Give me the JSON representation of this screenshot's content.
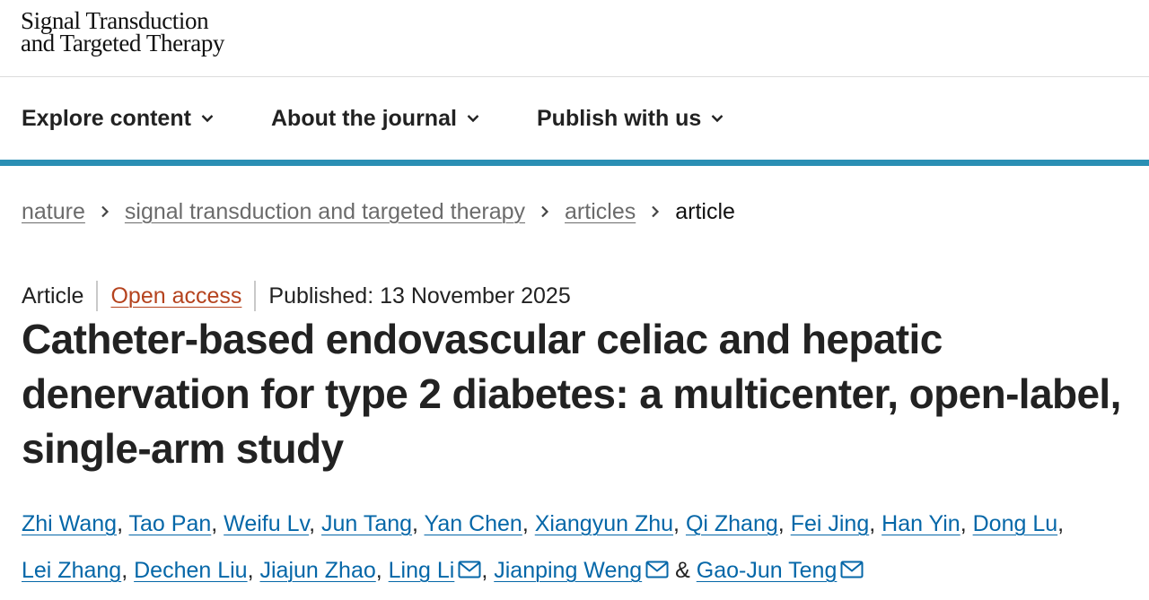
{
  "header": {
    "logo_line1": "Signal Transduction",
    "logo_line2": "and Targeted Therapy"
  },
  "nav": {
    "items": [
      {
        "label": "Explore content",
        "icon": "chevron-down-icon"
      },
      {
        "label": "About the journal",
        "icon": "chevron-down-icon"
      },
      {
        "label": "Publish with us",
        "icon": "chevron-down-icon"
      }
    ],
    "accent_color": "#2a8fb4"
  },
  "breadcrumb": {
    "items": [
      "nature",
      "signal transduction and targeted therapy",
      "articles"
    ],
    "current": "article"
  },
  "article": {
    "type": "Article",
    "access": "Open access",
    "published": "Published: 13 November 2025",
    "title": "Catheter-based endovascular celiac and hepatic denervation for type 2 diabetes: a multicenter, open-label, single-arm study",
    "link_color": "#0567a8",
    "access_color": "#b5431e"
  },
  "authors": {
    "line1": [
      "Zhi Wang",
      "Tao Pan",
      "Weifu Lv",
      "Jun Tang",
      "Yan Chen",
      "Xiangyun Zhu",
      "Qi Zhang",
      "Fei Jing",
      "Han Yin",
      "Dong Lu"
    ],
    "line2": [
      "Lei Zhang",
      "Dechen Liu",
      "Jiajun Zhao",
      "Ling Li",
      "Jianping Weng",
      "Gao-Jun Teng"
    ],
    "separator": ", ",
    "and": "&",
    "mail_icon": "envelope-icon"
  }
}
